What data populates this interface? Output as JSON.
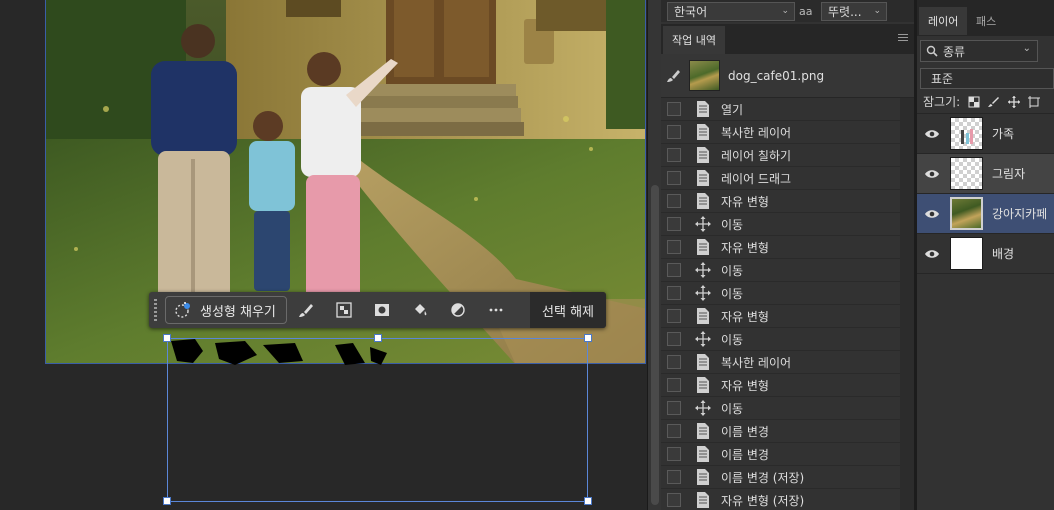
{
  "character_panel": {
    "language": "한국어",
    "font_size_icon": "aa",
    "antialias": "뚜렷..."
  },
  "history_panel": {
    "tab_label": "작업 내역",
    "snapshot_name": "dog_cafe01.png",
    "steps": [
      {
        "label": "열기",
        "icon": "document-icon"
      },
      {
        "label": "복사한 레이어",
        "icon": "document-icon"
      },
      {
        "label": "레이어 칠하기",
        "icon": "document-icon"
      },
      {
        "label": "레이어 드래그",
        "icon": "document-icon"
      },
      {
        "label": "자유 변형",
        "icon": "document-icon"
      },
      {
        "label": "이동",
        "icon": "move-icon"
      },
      {
        "label": "자유 변형",
        "icon": "document-icon"
      },
      {
        "label": "이동",
        "icon": "move-icon"
      },
      {
        "label": "이동",
        "icon": "move-icon"
      },
      {
        "label": "자유 변형",
        "icon": "document-icon"
      },
      {
        "label": "이동",
        "icon": "move-icon"
      },
      {
        "label": "복사한 레이어",
        "icon": "document-icon"
      },
      {
        "label": "자유 변형",
        "icon": "document-icon"
      },
      {
        "label": "이동",
        "icon": "move-icon"
      },
      {
        "label": "이름 변경",
        "icon": "document-icon"
      },
      {
        "label": "이름 변경",
        "icon": "document-icon"
      },
      {
        "label": "이름 변경 (저장)",
        "icon": "document-icon"
      },
      {
        "label": "자유 변형 (저장)",
        "icon": "document-icon"
      }
    ]
  },
  "layers_panel": {
    "tabs": [
      "레이어",
      "패스"
    ],
    "kind_filter": "종류",
    "blend_mode": "표준",
    "lock_label": "잠그기:",
    "layers": [
      {
        "name": "가족",
        "thumb": "transparent-figure",
        "state": "normal"
      },
      {
        "name": "그림자",
        "thumb": "transparent",
        "state": "hover"
      },
      {
        "name": "강아지카페",
        "thumb": "photo",
        "state": "selected"
      },
      {
        "name": "배경",
        "thumb": "white",
        "state": "normal"
      }
    ]
  },
  "contextual_taskbar": {
    "generative_fill_label": "생성형 채우기",
    "deselect_label": "선택 해제",
    "tools": [
      "brush-icon",
      "checker-mask-icon",
      "mask-icon",
      "fill-bucket-icon",
      "contrast-icon",
      "more-icon"
    ]
  },
  "colors": {
    "selection": "#5b87d8",
    "selected_layer": "#3e4f74",
    "panel_bg": "#323232"
  }
}
